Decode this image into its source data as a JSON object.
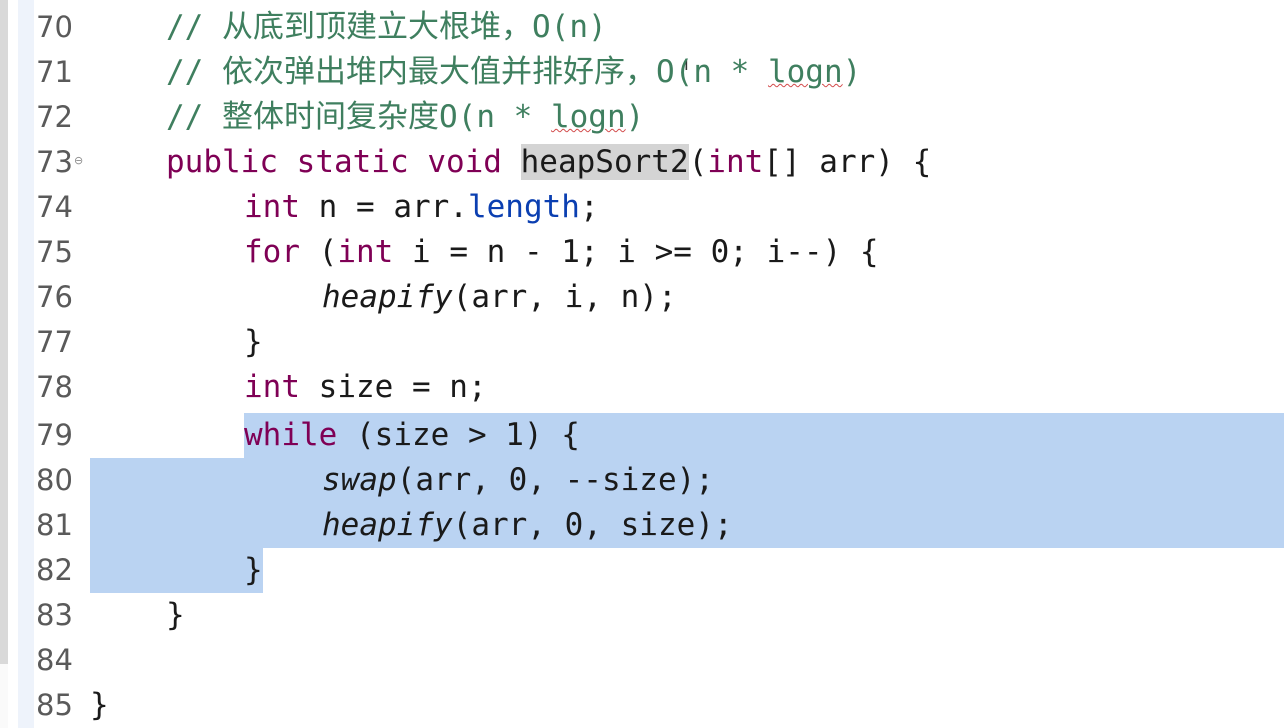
{
  "editor": {
    "lines": [
      {
        "no": "70",
        "comment": "// 从底到顶建立大根堆，O(n)"
      },
      {
        "no": "71",
        "comment_a": "// 依次弹出堆内最大值并排好序，O(n * ",
        "comment_b": "logn",
        "comment_c": ")"
      },
      {
        "no": "72",
        "comment_a": "// 整体时间复杂度O(n * ",
        "comment_b": "logn",
        "comment_c": ")"
      },
      {
        "no": "73",
        "kw1": "public",
        "kw2": "static",
        "kw3": "void",
        "method": "heapSort2",
        "params_a": "(",
        "type": "int",
        "params_b": "[] arr) {"
      },
      {
        "no": "74",
        "kw": "int",
        "rest_a": " n = arr.",
        "field": "length",
        "rest_b": ";"
      },
      {
        "no": "75",
        "kw1": "for",
        "rest_a": " (",
        "kw2": "int",
        "rest_b": " i = n - 1; i >= 0; i--) {"
      },
      {
        "no": "76",
        "call": "heapify",
        "rest": "(arr, i, n);"
      },
      {
        "no": "77",
        "text": "}"
      },
      {
        "no": "78",
        "kw": "int",
        "rest": " size = n;"
      },
      {
        "no": "79",
        "kw": "while",
        "rest": " (size > 1) {"
      },
      {
        "no": "80",
        "call": "swap",
        "rest": "(arr, 0, --size);"
      },
      {
        "no": "81",
        "call": "heapify",
        "rest": "(arr, 0, size);"
      },
      {
        "no": "82",
        "text": "}"
      },
      {
        "no": "83",
        "text": "}"
      },
      {
        "no": "84",
        "text": ""
      },
      {
        "no": "85",
        "text": "}"
      }
    ],
    "fold_marker": "⊖",
    "colors": {
      "keyword": "#7f0055",
      "comment": "#3f7f5f",
      "field": "#0b3fb1",
      "selection": "#bad3f2",
      "occurrence_highlight": "#d4d4d4"
    }
  }
}
